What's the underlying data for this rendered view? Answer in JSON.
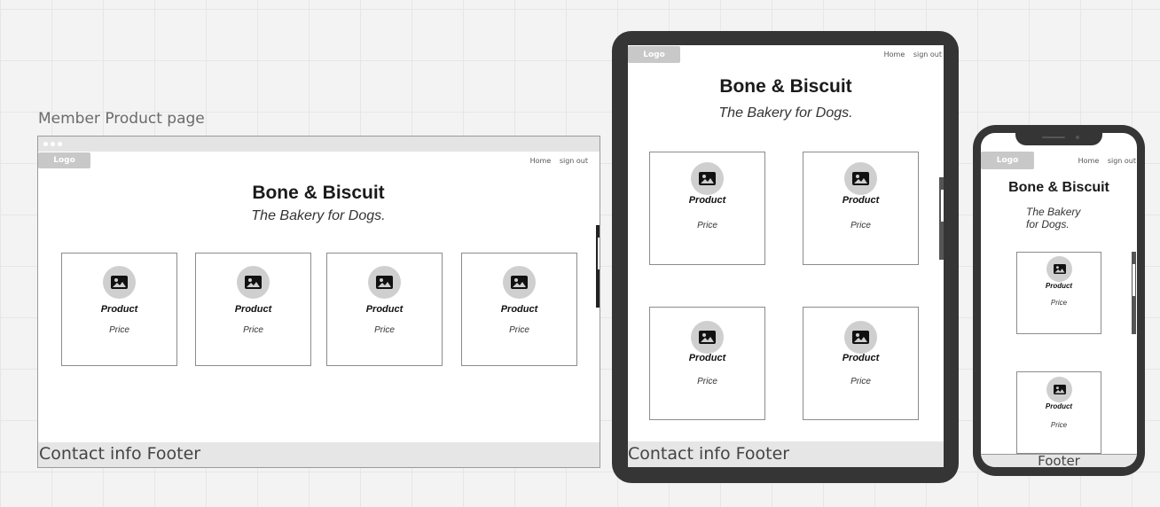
{
  "canvas": {
    "frame_label": "Member Product page"
  },
  "site": {
    "logo": "Logo",
    "nav": [
      "Home",
      "sign out"
    ],
    "title": "Bone & Biscuit",
    "subtitle": "The Bakery for Dogs.",
    "subtitle_phone_line1": "The Bakery",
    "subtitle_phone_line2": "for Dogs."
  },
  "products": [
    {
      "name": "Product",
      "price": "Price"
    },
    {
      "name": "Product",
      "price": "Price"
    },
    {
      "name": "Product",
      "price": "Price"
    },
    {
      "name": "Product",
      "price": "Price"
    }
  ],
  "footer": {
    "desktop": "Contact info Footer",
    "tablet": "Contact info Footer",
    "phone": "Footer"
  },
  "colors": {
    "device_frame": "#353535",
    "placeholder_grey": "#cfcfcf",
    "footer_bg": "#e6e6e6"
  },
  "icons": {
    "product_image": "image-icon"
  }
}
